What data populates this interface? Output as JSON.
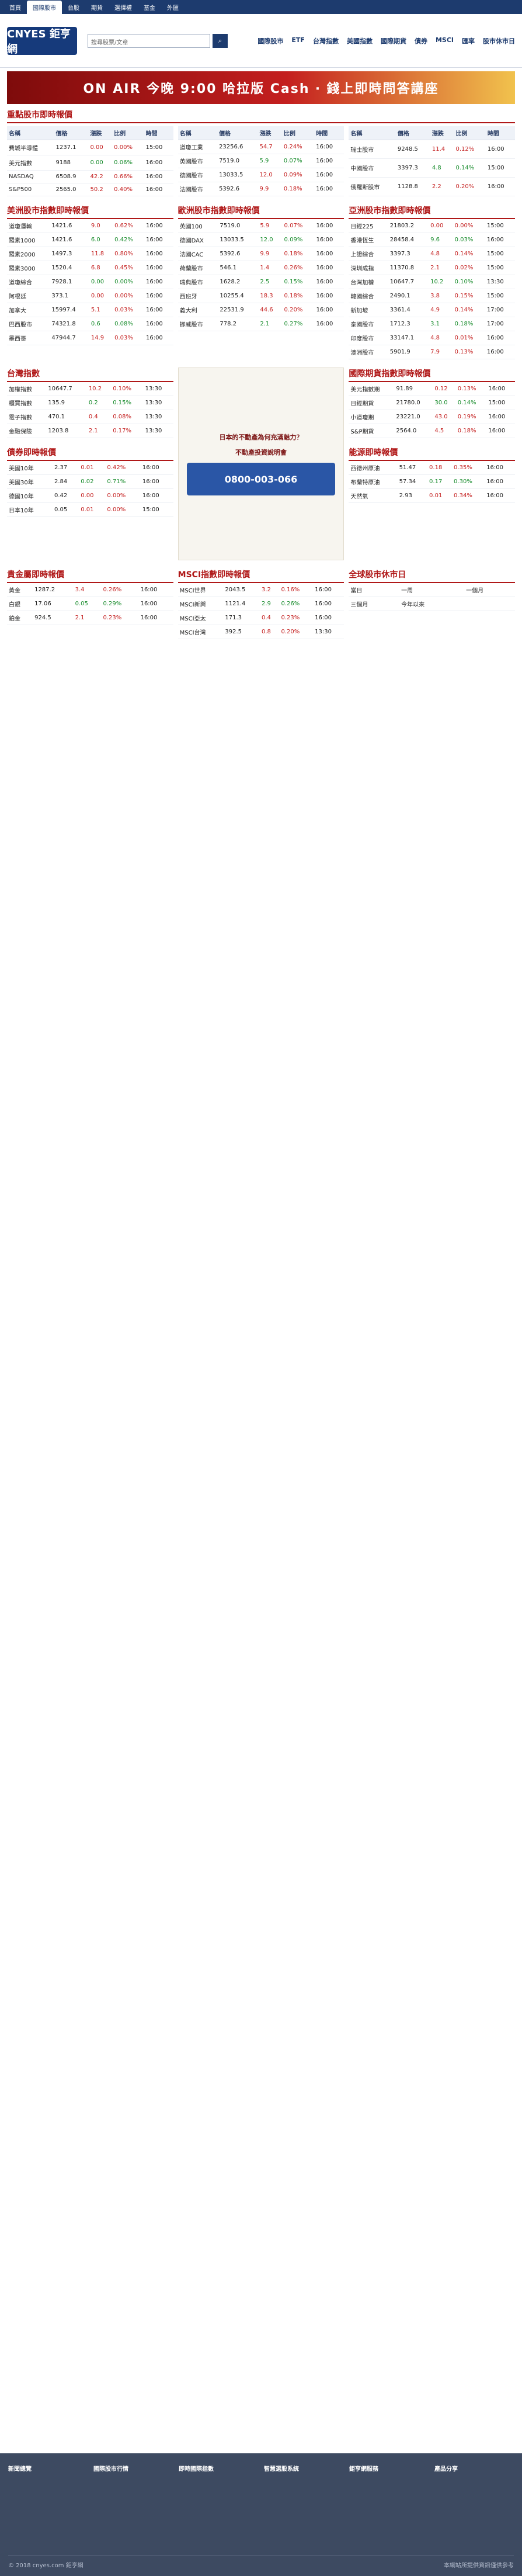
{
  "topnav": {
    "items": [
      "首頁",
      "國際股市",
      "台股",
      "期貨",
      "選擇權",
      "基金",
      "外匯"
    ],
    "active": "國際股市"
  },
  "header": {
    "logo": "CNYES 鉅亨網",
    "search_placeholder": "搜尋股票/文章",
    "nav": [
      "國際股市",
      "ETF",
      "台灣指數",
      "美國指數",
      "國際期貨",
      "債券",
      "MSCI",
      "匯率",
      "股市休市日"
    ]
  },
  "banner": {
    "text": "ON AIR 今晚 9:00 哈拉版 Cash ‧ 錢上即時問答講座"
  },
  "sections": {
    "global_indices": "重點股市即時報價",
    "us_indices": "美洲股市指數即時報價",
    "euro_indices": "歐洲股市指數即時報價",
    "asia_indices": "亞洲股市指數即時報價",
    "taiwan_indices": "台灣指數",
    "bond_indices": "債券即時報價",
    "futures": "國際期貨指數即時報價",
    "energy": "能源即時報價",
    "metals": "貴金屬即時報價",
    "msci": "MSCI指數即時報價",
    "holiday": "全球股市休市日",
    "today": "當日",
    "week": "一周",
    "month": "一個月",
    "quarter": "三個月",
    "ytd": "今年以來"
  },
  "table_headers": [
    "名稱",
    "價格",
    "漲跌",
    "比例",
    "時間"
  ],
  "global_rows": [
    [
      "費城半導體",
      "1237.1",
      "0.00",
      "0.00%",
      "15:00"
    ],
    [
      "美元指數",
      "9188",
      "0.00",
      "0.06%",
      "16:00"
    ],
    [
      "NASDAQ",
      "6508.9",
      "42.2",
      "0.66%",
      "16:00"
    ],
    [
      "S&P500",
      "2565.0",
      "50.2",
      "0.40%",
      "16:00"
    ],
    [
      "道瓊工業",
      "23256.6",
      "54.7",
      "0.24%",
      "16:00"
    ],
    [
      "英國股市",
      "7519.0",
      "5.9",
      "0.07%",
      "16:00"
    ],
    [
      "德國股市",
      "13033.5",
      "12.0",
      "0.09%",
      "16:00"
    ],
    [
      "法國股市",
      "5392.6",
      "9.9",
      "0.18%",
      "16:00"
    ],
    [
      "瑞士股市",
      "9248.5",
      "11.4",
      "0.12%",
      "16:00"
    ],
    [
      "中國股市",
      "3397.3",
      "4.8",
      "0.14%",
      "15:00"
    ],
    [
      "俄羅斯股市",
      "1128.8",
      "2.2",
      "0.20%",
      "16:00"
    ]
  ],
  "us_rows": [
    [
      "道瓊運輸",
      "1421.6",
      "9.0",
      "0.62%",
      "16:00"
    ],
    [
      "羅素1000",
      "1421.6",
      "6.0",
      "0.42%",
      "16:00"
    ],
    [
      "羅素2000",
      "1497.3",
      "11.8",
      "0.80%",
      "16:00"
    ],
    [
      "羅素3000",
      "1520.4",
      "6.8",
      "0.45%",
      "16:00"
    ],
    [
      "道瓊綜合",
      "7928.1",
      "0.00",
      "0.00%",
      "16:00"
    ],
    [
      "阿根廷",
      "373.1",
      "0.00",
      "0.00%",
      "16:00"
    ],
    [
      "加拿大",
      "15997.4",
      "5.1",
      "0.03%",
      "16:00"
    ],
    [
      "巴西股市",
      "74321.8",
      "0.6",
      "0.08%",
      "16:00"
    ],
    [
      "墨西哥",
      "47944.7",
      "14.9",
      "0.03%",
      "16:00"
    ]
  ],
  "euro_rows": [
    [
      "英國100",
      "7519.0",
      "5.9",
      "0.07%",
      "16:00"
    ],
    [
      "德國DAX",
      "13033.5",
      "12.0",
      "0.09%",
      "16:00"
    ],
    [
      "法國CAC",
      "5392.6",
      "9.9",
      "0.18%",
      "16:00"
    ],
    [
      "荷蘭股市",
      "546.1",
      "1.4",
      "0.26%",
      "16:00"
    ],
    [
      "瑞典股市",
      "1628.2",
      "2.5",
      "0.15%",
      "16:00"
    ],
    [
      "西班牙",
      "10255.4",
      "18.3",
      "0.18%",
      "16:00"
    ],
    [
      "義大利",
      "22531.9",
      "44.6",
      "0.20%",
      "16:00"
    ],
    [
      "挪威股市",
      "778.2",
      "2.1",
      "0.27%",
      "16:00"
    ]
  ],
  "asia_rows": [
    [
      "日經225",
      "21803.2",
      "0.00",
      "0.00%",
      "15:00"
    ],
    [
      "香港恆生",
      "28458.4",
      "9.6",
      "0.03%",
      "16:00"
    ],
    [
      "上證綜合",
      "3397.3",
      "4.8",
      "0.14%",
      "15:00"
    ],
    [
      "深圳成指",
      "11370.8",
      "2.1",
      "0.02%",
      "15:00"
    ],
    [
      "台灣加權",
      "10647.7",
      "10.2",
      "0.10%",
      "13:30"
    ],
    [
      "韓國綜合",
      "2490.1",
      "3.8",
      "0.15%",
      "15:00"
    ],
    [
      "新加坡",
      "3361.4",
      "4.9",
      "0.14%",
      "17:00"
    ],
    [
      "泰國股市",
      "1712.3",
      "3.1",
      "0.18%",
      "17:00"
    ],
    [
      "印度股市",
      "33147.1",
      "4.8",
      "0.01%",
      "16:00"
    ],
    [
      "澳洲股市",
      "5901.9",
      "7.9",
      "0.13%",
      "16:00"
    ]
  ],
  "taiwan_rows": [
    [
      "加權指數",
      "10647.7",
      "10.2",
      "0.10%",
      "13:30"
    ],
    [
      "櫃買指數",
      "135.9",
      "0.2",
      "0.15%",
      "13:30"
    ],
    [
      "電子指數",
      "470.1",
      "0.4",
      "0.08%",
      "13:30"
    ],
    [
      "金融保險",
      "1203.8",
      "2.1",
      "0.17%",
      "13:30"
    ]
  ],
  "bond_rows": [
    [
      "美國10年",
      "2.37",
      "0.01",
      "0.42%",
      "16:00"
    ],
    [
      "美國30年",
      "2.84",
      "0.02",
      "0.71%",
      "16:00"
    ],
    [
      "德國10年",
      "0.42",
      "0.00",
      "0.00%",
      "16:00"
    ],
    [
      "日本10年",
      "0.05",
      "0.01",
      "0.00%",
      "15:00"
    ]
  ],
  "futures_rows": [
    [
      "美元指數期",
      "91.89",
      "0.12",
      "0.13%",
      "16:00"
    ],
    [
      "日經期貨",
      "21780.0",
      "30.0",
      "0.14%",
      "15:00"
    ],
    [
      "小道瓊期",
      "23221.0",
      "43.0",
      "0.19%",
      "16:00"
    ],
    [
      "S&P期貨",
      "2564.0",
      "4.5",
      "0.18%",
      "16:00"
    ]
  ],
  "energy_rows": [
    [
      "西德州原油",
      "51.47",
      "0.18",
      "0.35%",
      "16:00"
    ],
    [
      "布蘭特原油",
      "57.34",
      "0.17",
      "0.30%",
      "16:00"
    ],
    [
      "天然氣",
      "2.93",
      "0.01",
      "0.34%",
      "16:00"
    ]
  ],
  "metals_rows": [
    [
      "黃金",
      "1287.2",
      "3.4",
      "0.26%",
      "16:00"
    ],
    [
      "白銀",
      "17.06",
      "0.05",
      "0.29%",
      "16:00"
    ],
    [
      "鉑金",
      "924.5",
      "2.1",
      "0.23%",
      "16:00"
    ]
  ],
  "msci_rows": [
    [
      "MSCI世界",
      "2043.5",
      "3.2",
      "0.16%",
      "16:00"
    ],
    [
      "MSCI新興",
      "1121.4",
      "2.9",
      "0.26%",
      "16:00"
    ],
    [
      "MSCI亞太",
      "171.3",
      "0.4",
      "0.23%",
      "16:00"
    ],
    [
      "MSCI台灣",
      "392.5",
      "0.8",
      "0.20%",
      "13:30"
    ]
  ],
  "side_ad": {
    "title": "日本的不動產為何充滿魅力？",
    "subtitle": "不動產投資說明會",
    "phone": "0800-003-066"
  },
  "footer": {
    "columns": [
      "新聞總覽",
      "國際股市行情",
      "即時國際指數",
      "智慧選股系統",
      "鉅亨網服務",
      "產品分享"
    ],
    "copyright": "© 2018 cnyes.com 鉅亨網",
    "note": "本網站所提供資訊僅供參考"
  }
}
